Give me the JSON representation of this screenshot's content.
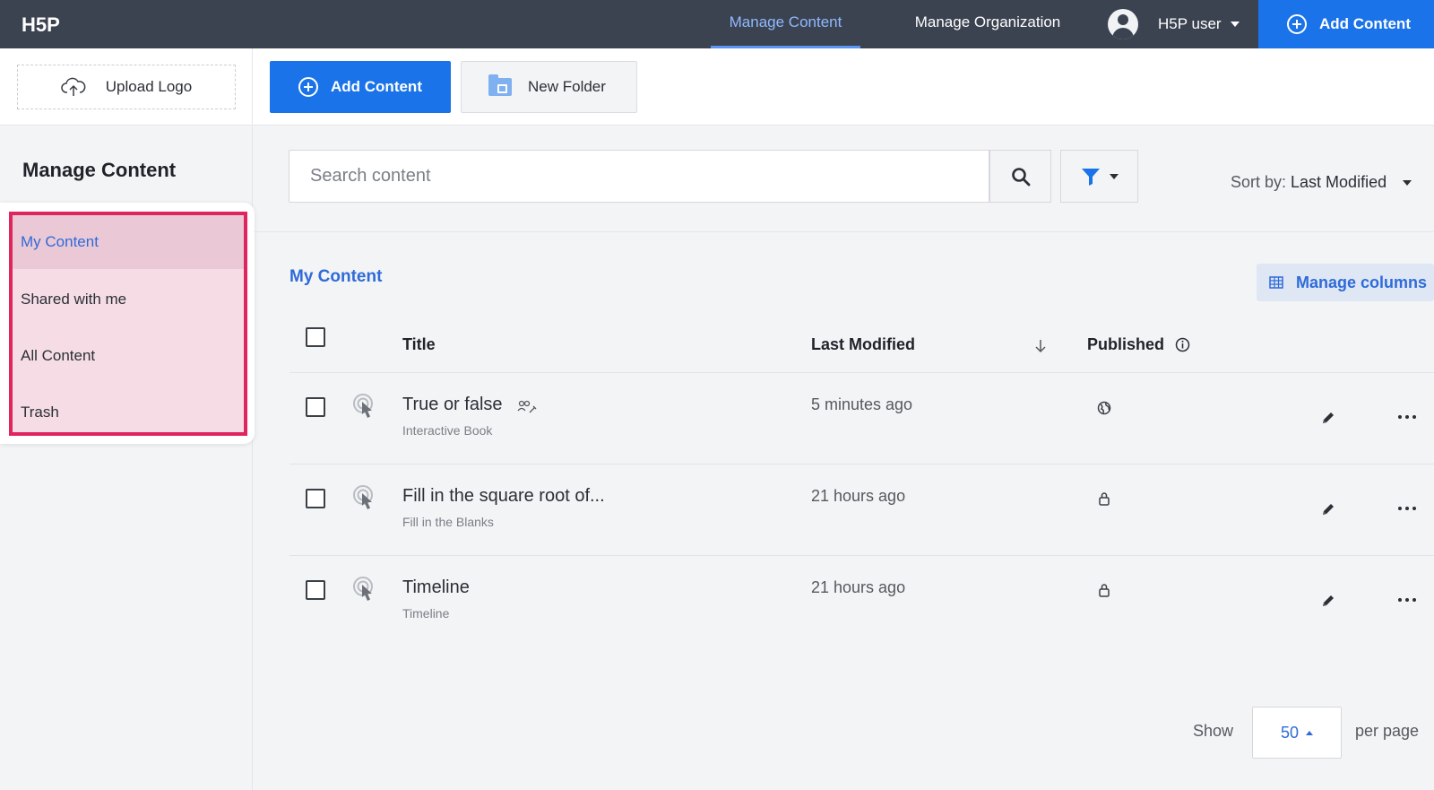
{
  "header": {
    "logo_text": "H5P",
    "tabs": [
      {
        "label": "Manage Content",
        "active": true
      },
      {
        "label": "Manage Organization",
        "active": false
      }
    ],
    "user_name": "H5P user",
    "add_content_label": "Add Content"
  },
  "toolbar": {
    "upload_logo_label": "Upload Logo",
    "add_content_label": "Add Content",
    "new_folder_label": "New Folder"
  },
  "sidebar": {
    "title": "Manage Content",
    "items": [
      {
        "label": "My Content",
        "active": true
      },
      {
        "label": "Shared with me",
        "active": false
      },
      {
        "label": "All Content",
        "active": false
      },
      {
        "label": "Trash",
        "active": false
      }
    ],
    "highlight_color": "#e0245e"
  },
  "search": {
    "placeholder": "Search content",
    "sort_prefix": "Sort by:",
    "sort_value": "Last Modified"
  },
  "list": {
    "title": "My Content",
    "manage_columns_label": "Manage columns",
    "columns": {
      "title": "Title",
      "last_modified": "Last Modified",
      "published": "Published"
    },
    "rows": [
      {
        "title": "True or false",
        "type": "Interactive Book",
        "modified": "5 minutes ago",
        "status": "public",
        "shared": true
      },
      {
        "title": "Fill in the square root of...",
        "type": "Fill in the Blanks",
        "modified": "21 hours ago",
        "status": "private",
        "shared": false
      },
      {
        "title": "Timeline",
        "type": "Timeline",
        "modified": "21 hours ago",
        "status": "private",
        "shared": false
      }
    ]
  },
  "pagination": {
    "show_label": "Show",
    "per_page_value": "50",
    "per_page_label": "per page"
  },
  "colors": {
    "topbar": "#3c4350",
    "accent": "#1a73e8",
    "link": "#2f6bd8"
  }
}
